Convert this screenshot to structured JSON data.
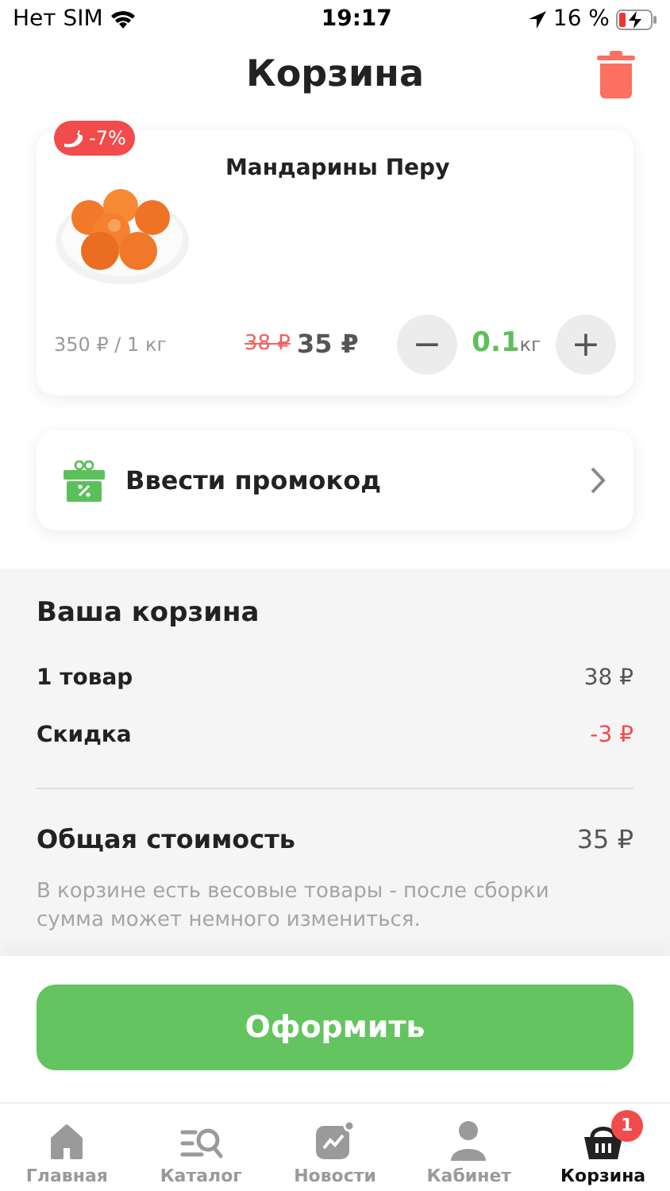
{
  "status_bar": {
    "carrier": "Нет SIM",
    "time": "19:17",
    "battery": "16 %"
  },
  "header": {
    "title": "Корзина"
  },
  "product": {
    "badge": "-7%",
    "name": "Мандарины Перу",
    "unit_price": "350 ₽ / 1 кг",
    "old_price": "38 ₽",
    "price": "35 ₽",
    "quantity": "0.1",
    "unit": "кг",
    "decrease": "−",
    "increase": "+"
  },
  "promo": {
    "label": "Ввести промокод"
  },
  "summary": {
    "title": "Ваша корзина",
    "rows": [
      {
        "label": "1 товар",
        "value": "38 ₽",
        "kind": "normal"
      },
      {
        "label": "Скидка",
        "value": "-3 ₽",
        "kind": "discount"
      }
    ],
    "total_label": "Общая стоимость",
    "total_value": "35 ₽",
    "note": "В корзине есть весовые товары - после сборки сумма может немного измениться."
  },
  "checkout_button": "Оформить",
  "tabs": [
    {
      "label": "Главная",
      "kind": "home",
      "selected": false
    },
    {
      "label": "Каталог",
      "kind": "catalog",
      "selected": false
    },
    {
      "label": "Новости",
      "kind": "news",
      "selected": false
    },
    {
      "label": "Кабинет",
      "kind": "profile",
      "selected": false
    },
    {
      "label": "Корзина",
      "kind": "basket",
      "selected": true,
      "badge": "1"
    }
  ]
}
